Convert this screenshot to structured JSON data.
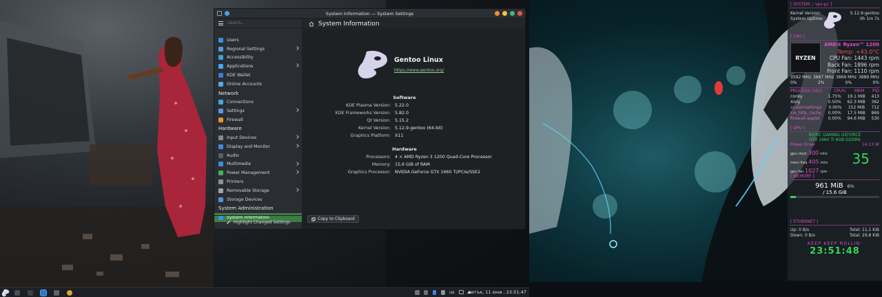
{
  "window": {
    "title": "System Information — System Settings",
    "controls": [
      {
        "name": "minimize",
        "color": "#f28d3a"
      },
      {
        "name": "keep-above",
        "color": "#f3c53c"
      },
      {
        "name": "maximize",
        "color": "#43b581"
      },
      {
        "name": "close",
        "color": "#e8524a"
      }
    ]
  },
  "sidebar": {
    "search_placeholder": "Search...",
    "items": [
      {
        "type": "item",
        "label": "Users",
        "icon": "users-icon",
        "color": "#3d8fdb",
        "chevron": false
      },
      {
        "type": "item",
        "label": "Regional Settings",
        "icon": "globe-icon",
        "color": "#4d9be6",
        "chevron": true
      },
      {
        "type": "item",
        "label": "Accessibility",
        "icon": "accessibility-icon",
        "color": "#3aa0e0",
        "chevron": false
      },
      {
        "type": "item",
        "label": "Applications",
        "icon": "applications-icon",
        "color": "#47a6f0",
        "chevron": true
      },
      {
        "type": "item",
        "label": "KDE Wallet",
        "icon": "wallet-icon",
        "color": "#3a7bd5",
        "chevron": false
      },
      {
        "type": "item",
        "label": "Online Accounts",
        "icon": "accounts-icon",
        "color": "#5aa7e8",
        "chevron": false
      },
      {
        "type": "category",
        "label": "Network"
      },
      {
        "type": "item",
        "label": "Connections",
        "icon": "connections-icon",
        "color": "#46a3e6",
        "chevron": false
      },
      {
        "type": "item",
        "label": "Settings",
        "icon": "network-settings-icon",
        "color": "#5a98d8",
        "chevron": true
      },
      {
        "type": "item",
        "label": "Firewall",
        "icon": "firewall-icon",
        "color": "#e29a2f",
        "chevron": false
      },
      {
        "type": "category",
        "label": "Hardware"
      },
      {
        "type": "item",
        "label": "Input Devices",
        "icon": "keyboard-icon",
        "color": "#7d8a96",
        "chevron": true
      },
      {
        "type": "item",
        "label": "Display and Monitor",
        "icon": "monitor-icon",
        "color": "#3f8ad6",
        "chevron": true
      },
      {
        "type": "item",
        "label": "Audio",
        "icon": "audio-icon",
        "color": "#55606b",
        "chevron": false
      },
      {
        "type": "item",
        "label": "Multimedia",
        "icon": "multimedia-icon",
        "color": "#3c8fd9",
        "chevron": true
      },
      {
        "type": "item",
        "label": "Power Management",
        "icon": "power-icon",
        "color": "#48b05a",
        "chevron": true
      },
      {
        "type": "item",
        "label": "Printers",
        "icon": "printer-icon",
        "color": "#8a949e",
        "chevron": false
      },
      {
        "type": "item",
        "label": "Removable Storage",
        "icon": "removable-storage-icon",
        "color": "#9aa4ae",
        "chevron": true
      },
      {
        "type": "item",
        "label": "Storage Devices",
        "icon": "storage-icon",
        "color": "#4d96dd",
        "chevron": false
      },
      {
        "type": "category",
        "label": "System Administration"
      },
      {
        "type": "item",
        "label": "System Information",
        "icon": "info-icon",
        "color": "#3d8fdb",
        "chevron": false,
        "selected": true
      }
    ],
    "bottom_button": "Highlight Changed Settings"
  },
  "main": {
    "title": "System Information",
    "distro_name": "Gentoo Linux",
    "distro_url": "https://www.gentoo.org/",
    "software_title": "Software",
    "software": [
      {
        "key": "KDE Plasma Version:",
        "value": "5.22.0"
      },
      {
        "key": "KDE Frameworks Version:",
        "value": "5.82.0"
      },
      {
        "key": "Qt Version:",
        "value": "5.15.2"
      },
      {
        "key": "Kernel Version:",
        "value": "5.12.9-gentoo (64-bit)"
      },
      {
        "key": "Graphics Platform:",
        "value": "X11"
      }
    ],
    "hardware_title": "Hardware",
    "hardware": [
      {
        "key": "Processors:",
        "value": "4 × AMD Ryzen 3 1200 Quad-Core Processor"
      },
      {
        "key": "Memory:",
        "value": "15,6 GiB of RAM"
      },
      {
        "key": "Graphics Processor:",
        "value": "NVIDIA GeForce GTX 1660 Ti/PCIe/SSE2"
      }
    ],
    "copy_button": "Copy to Clipboard"
  },
  "conky": {
    "system_header": "[ SYSTEM :: vpv-pc ]",
    "kernel_label": "Kernel Version:",
    "kernel_value": "5.12.9-gentoo",
    "uptime_label": "System Uptime:",
    "uptime_value": "0h 1m 7s",
    "cpu_header": "[ CPU ]",
    "cpu_name": "AMD® Ryzen™ 1200",
    "cpu_temp": "Temp: +43.0°C",
    "cpu_fan": "CPU Fan: 1443 rpm",
    "back_fan": "Back Fan: 1896 rpm",
    "front_fan": "Front Fan: 1110 rpm",
    "freqs": [
      "3592 MHz",
      "3887 MHz",
      "3869 MHz",
      "3889 MHz"
    ],
    "cpu_usage": [
      "0%",
      "2%",
      "0%",
      "0%"
    ],
    "process_header": "PROCESS (161)",
    "process_cols": [
      "CPU%",
      "MEM",
      "PID"
    ],
    "processes": [
      {
        "name": "conky",
        "cpu": "1.75%",
        "mem": "19.1 MiB",
        "pid": "413"
      },
      {
        "name": "Xorg",
        "cpu": "0.50%",
        "mem": "62.3 MiB",
        "pid": "362"
      },
      {
        "name": "systemsettings5",
        "cpu": "0.00%",
        "mem": "152 MiB",
        "pid": "712"
      },
      {
        "name": "kio_http_cache_",
        "cpu": "0.00%",
        "mem": "17.5 MiB",
        "pid": "869"
      },
      {
        "name": "firewall-applet",
        "cpu": "0.00%",
        "mem": "94.6 MiB",
        "pid": "530"
      }
    ],
    "gpu_header": "[ GPU ]",
    "gpu_name": "ROTIC GAMING GEFORCE",
    "gpu_sub": "GTX 1660 Ti 6GB GDDR6",
    "power_label": "Power Draw",
    "power_value": "14.13 W",
    "gpu_clock_label": "gpu clock",
    "gpu_clock": "300",
    "mem_freq_label": "mem freq",
    "mem_freq": "405",
    "fan_label": "gpu fan",
    "fan_value": "1027",
    "mhz_unit": "mhz",
    "rpm_unit": "rpm",
    "gpu_temp": "35",
    "memory_header": "[ MEMORY ]",
    "mem_used": "961 MiB",
    "mem_total": "/ 15.6 GiB",
    "mem_pct": "6%",
    "ethernet_header": "[ ETHERNET ]",
    "up_label": "Up:",
    "up_value": "0 B/s",
    "down_label": "Down:",
    "down_value": "0 B/s",
    "total_label": "Total:",
    "total_up": "11,1 KiB",
    "total_down": "29,8 KiB",
    "tagline": "KEEP KEEP ROLLIN'",
    "time": "23:51:48"
  },
  "taskbar": {
    "keyboard_layout": "us",
    "clock": "петък, 11 юни , 23:51:47"
  }
}
